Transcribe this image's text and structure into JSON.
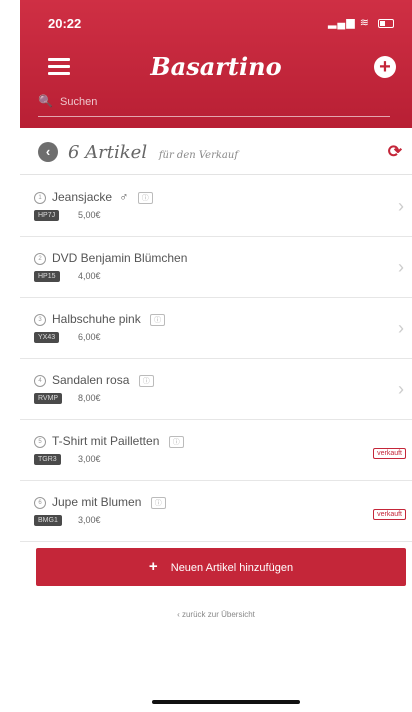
{
  "status_bar": {
    "time": "20:22"
  },
  "header": {
    "brand": "Basartino",
    "search_placeholder": "Suchen"
  },
  "subheader": {
    "title": "6 Artikel",
    "subtitle": "für den Verkauf"
  },
  "items": [
    {
      "name": "Jeansjacke",
      "code": "HP7J",
      "price": "5,00€",
      "sold": false
    },
    {
      "name": "DVD Benjamin Blümchen",
      "code": "HP15",
      "price": "4,00€",
      "sold": false
    },
    {
      "name": "Halbschuhe pink",
      "code": "YX43",
      "price": "6,00€",
      "sold": false
    },
    {
      "name": "Sandalen rosa",
      "code": "RVMP",
      "price": "8,00€",
      "sold": false
    },
    {
      "name": "T-Shirt mit Pailletten",
      "code": "TGR3",
      "price": "3,00€",
      "sold": true,
      "sold_label": "verkauft"
    },
    {
      "name": "Jupe mit Blumen",
      "code": "BMG1",
      "price": "3,00€",
      "sold": true,
      "sold_label": "verkauft"
    }
  ],
  "add_button_label": "Neuen Artikel hinzufügen",
  "back_link": "zurück zur Übersicht",
  "colors": {
    "brand": "#c42639"
  }
}
